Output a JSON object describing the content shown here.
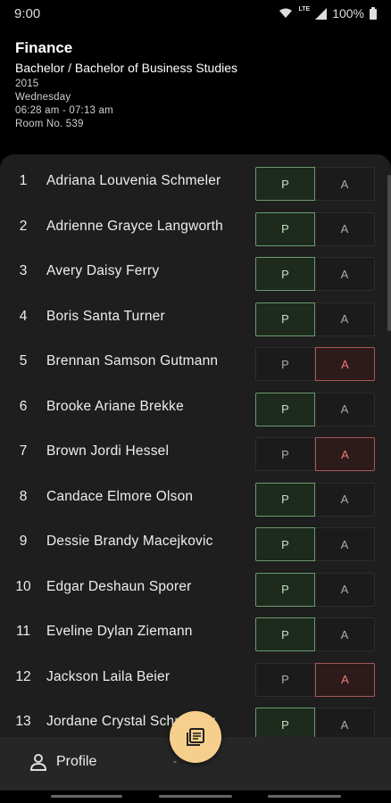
{
  "status_bar": {
    "time": "9:00",
    "network": "LTE",
    "battery": "100%"
  },
  "header": {
    "title": "Finance",
    "course": "Bachelor / Bachelor of Business Studies",
    "year": "2015",
    "day": "Wednesday",
    "time": "06:28 am - 07:13 am",
    "room": "Room No. 539"
  },
  "buttons": {
    "present": "P",
    "absent": "A"
  },
  "students": [
    {
      "num": "1",
      "name": "Adriana Louvenia Schmeler",
      "status": "P"
    },
    {
      "num": "2",
      "name": "Adrienne Grayce Langworth",
      "status": "P"
    },
    {
      "num": "3",
      "name": "Avery Daisy Ferry",
      "status": "P"
    },
    {
      "num": "4",
      "name": "Boris Santa Turner",
      "status": "P"
    },
    {
      "num": "5",
      "name": "Brennan Samson Gutmann",
      "status": "A"
    },
    {
      "num": "6",
      "name": "Brooke Ariane Brekke",
      "status": "P"
    },
    {
      "num": "7",
      "name": "Brown Jordi Hessel",
      "status": "A"
    },
    {
      "num": "8",
      "name": "Candace Elmore Olson",
      "status": "P"
    },
    {
      "num": "9",
      "name": "Dessie Brandy Macejkovic",
      "status": "P"
    },
    {
      "num": "10",
      "name": "Edgar Deshaun Sporer",
      "status": "P"
    },
    {
      "num": "11",
      "name": "Eveline Dylan Ziemann",
      "status": "P"
    },
    {
      "num": "12",
      "name": "Jackson Laila Beier",
      "status": "A"
    },
    {
      "num": "13",
      "name": "Jordane Crystal Schroeder",
      "status": "P"
    }
  ],
  "bottom_nav": {
    "profile_label": "Profile",
    "other_label": "-"
  },
  "fab": {
    "icon": "notes-icon"
  },
  "colors": {
    "present": "#6a9b6d",
    "absent": "#a85656",
    "fab": "#f7cf8c",
    "sheet": "#1e1e1e"
  }
}
